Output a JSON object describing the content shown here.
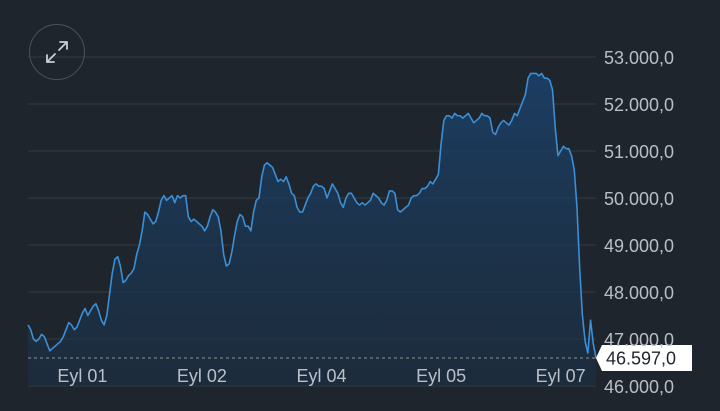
{
  "chart_data": {
    "type": "area",
    "title": "",
    "xlabel": "",
    "ylabel": "",
    "ylim": [
      46000,
      53000
    ],
    "grid": true,
    "y_ticks": [
      "53.000,0",
      "52.000,0",
      "51.000,0",
      "50.000,0",
      "49.000,0",
      "48.000,0",
      "47.000,0",
      "46.000,0"
    ],
    "y_tick_values": [
      53000,
      52000,
      51000,
      50000,
      49000,
      48000,
      47000,
      46000
    ],
    "x_ticks": [
      "Eyl 01",
      "Eyl 02",
      "Eyl 04",
      "Eyl 05",
      "Eyl 07"
    ],
    "x_tick_index": [
      20,
      64,
      108,
      152,
      196
    ],
    "last_value": 46597,
    "last_value_label": "46.597,0",
    "series": [
      {
        "values": [
          47300,
          47200,
          47000,
          46950,
          47000,
          47100,
          47050,
          46900,
          46750,
          46800,
          46850,
          46900,
          46950,
          47050,
          47200,
          47350,
          47300,
          47200,
          47250,
          47400,
          47550,
          47650,
          47500,
          47600,
          47700,
          47750,
          47600,
          47400,
          47300,
          47500,
          47950,
          48400,
          48700,
          48750,
          48550,
          48200,
          48250,
          48350,
          48400,
          48500,
          48800,
          49000,
          49300,
          49700,
          49650,
          49550,
          49450,
          49500,
          49700,
          49950,
          50050,
          49950,
          50000,
          50050,
          49900,
          50050,
          50000,
          50050,
          50050,
          49600,
          49500,
          49550,
          49500,
          49450,
          49400,
          49300,
          49400,
          49600,
          49750,
          49700,
          49600,
          49300,
          48800,
          48550,
          48600,
          48850,
          49200,
          49500,
          49650,
          49600,
          49400,
          49400,
          49300,
          49700,
          49950,
          50000,
          50450,
          50700,
          50750,
          50700,
          50650,
          50500,
          50350,
          50400,
          50350,
          50450,
          50300,
          50100,
          50050,
          49800,
          49700,
          49700,
          49850,
          50000,
          50100,
          50250,
          50300,
          50250,
          50250,
          50200,
          50000,
          50150,
          50300,
          50200,
          50100,
          49900,
          49800,
          50000,
          50100,
          50100,
          50000,
          49900,
          49850,
          49900,
          49850,
          49900,
          49950,
          50100,
          50050,
          50000,
          49900,
          49850,
          49950,
          50150,
          50150,
          50100,
          49750,
          49700,
          49750,
          49800,
          49850,
          50000,
          50050,
          50050,
          50100,
          50200,
          50200,
          50250,
          50350,
          50300,
          50400,
          50500,
          51150,
          51650,
          51750,
          51750,
          51700,
          51800,
          51750,
          51750,
          51700,
          51750,
          51800,
          51700,
          51600,
          51650,
          51700,
          51800,
          51750,
          51750,
          51700,
          51400,
          51350,
          51500,
          51600,
          51650,
          51600,
          51550,
          51650,
          51800,
          51750,
          51900,
          52050,
          52200,
          52550,
          52650,
          52650,
          52650,
          52600,
          52650,
          52550,
          52550,
          52500,
          52300,
          51500,
          50900,
          51000,
          51100,
          51050,
          51050,
          50900,
          50600,
          49800,
          48500,
          47500,
          46950,
          46700,
          47400,
          46900,
          46597
        ]
      }
    ]
  },
  "controls": {
    "expand_icon": "expand-arrows-icon"
  },
  "colors": {
    "background": "#1f252d",
    "grid": "#353c45",
    "line": "#3a8fd6",
    "area": "#1a3550",
    "tick_text": "#b9bfc6",
    "last_label_bg": "#ffffff",
    "last_label_text": "#1f252d"
  }
}
